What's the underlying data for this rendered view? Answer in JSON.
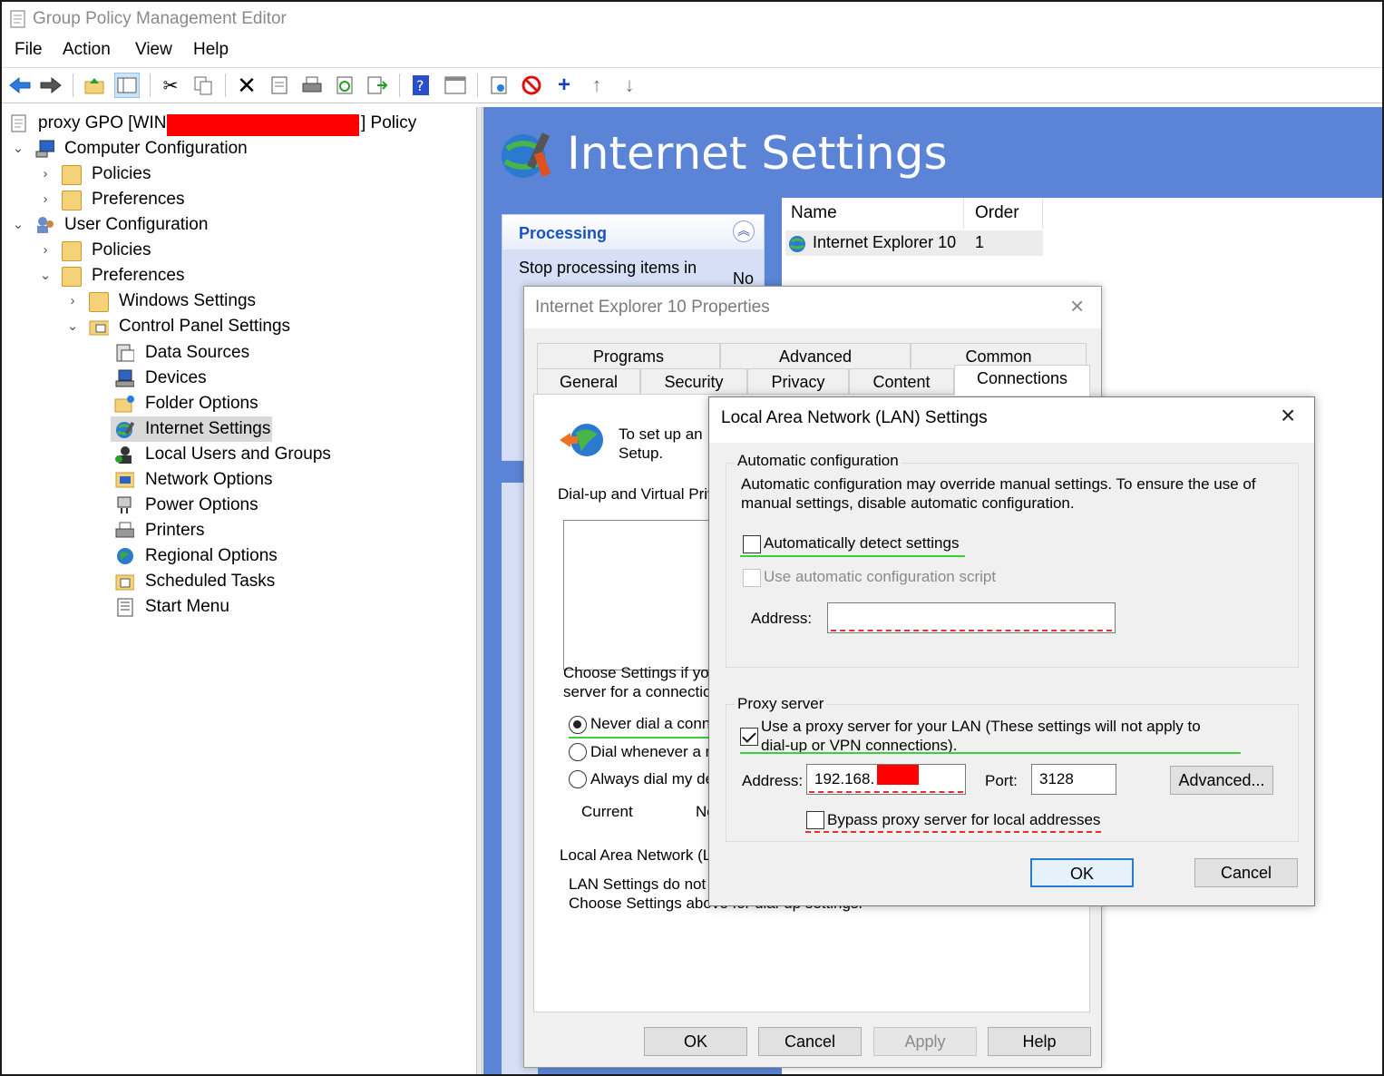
{
  "window": {
    "title": "Group Policy Management Editor"
  },
  "menu": [
    "File",
    "Action",
    "View",
    "Help"
  ],
  "toolbar": {
    "icons": [
      "back-icon",
      "forward-icon",
      "up-folder-icon",
      "show-hide-tree-icon",
      "cut-icon",
      "copy-icon",
      "delete-icon",
      "properties-icon",
      "print-icon",
      "refresh-icon",
      "export-icon",
      "help-icon",
      "console-icon",
      "new-item-icon",
      "stop-icon",
      "add-icon",
      "move-up-icon",
      "move-down-icon"
    ]
  },
  "tree": {
    "root_prefix": "proxy GPO [WIN-",
    "root_suffix": "] Policy",
    "computer_config": "Computer Configuration",
    "cc_policies": "Policies",
    "cc_preferences": "Preferences",
    "user_config": "User Configuration",
    "uc_policies": "Policies",
    "uc_preferences": "Preferences",
    "windows_settings": "Windows Settings",
    "control_panel": "Control Panel Settings",
    "items": [
      "Data Sources",
      "Devices",
      "Folder Options",
      "Internet Settings",
      "Local Users and Groups",
      "Network Options",
      "Power Options",
      "Printers",
      "Regional Options",
      "Scheduled Tasks",
      "Start Menu"
    ]
  },
  "right": {
    "header_title": "Internet Settings",
    "processing_title": "Processing",
    "processing_text": "Stop processing items in",
    "processing_value": "No",
    "columns": [
      "Name",
      "Order"
    ],
    "row": {
      "name": "Internet Explorer 10",
      "order": "1"
    }
  },
  "ie_dialog": {
    "title": "Internet Explorer 10 Properties",
    "tabs_row1": [
      "Programs",
      "Advanced",
      "Common"
    ],
    "tabs_row2": [
      "General",
      "Security",
      "Privacy",
      "Content",
      "Connections"
    ],
    "setup_text_1": "To set up an",
    "setup_text_2": "Setup.",
    "dialup_label": "Dial-up and Virtual Priv",
    "choose_1": "Choose Settings if yo",
    "choose_2": "server for a connectio",
    "radio_never": "Never dial a conn",
    "radio_whenever": "Dial whenever a n",
    "radio_always": "Always dial my de",
    "current_label": "Current",
    "current_value": "No",
    "lan_label": "Local Area Network (L",
    "lan_text_1": "LAN Settings do not a",
    "lan_text_2": "Choose Settings above for dial-up settings.",
    "buttons": {
      "ok": "OK",
      "cancel": "Cancel",
      "apply": "Apply",
      "help": "Help"
    }
  },
  "lan_dialog": {
    "title": "Local Area Network (LAN) Settings",
    "auto_group": "Automatic configuration",
    "auto_text_1": "Automatic configuration may override manual settings.  To ensure the use of",
    "auto_text_2": "manual settings, disable automatic configuration.",
    "auto_detect": "Automatically detect settings",
    "auto_script": "Use automatic configuration script",
    "address_label": "Address:",
    "address_value": "",
    "proxy_group": "Proxy server",
    "use_proxy_1": "Use a proxy server for your LAN (These settings will not apply to",
    "use_proxy_2": "dial-up or VPN connections).",
    "proxy_address_label": "Address:",
    "proxy_address_value": "192.168.",
    "port_label": "Port:",
    "port_value": "3128",
    "advanced_button": "Advanced...",
    "bypass": "Bypass proxy server for local addresses",
    "ok": "OK",
    "cancel": "Cancel"
  }
}
